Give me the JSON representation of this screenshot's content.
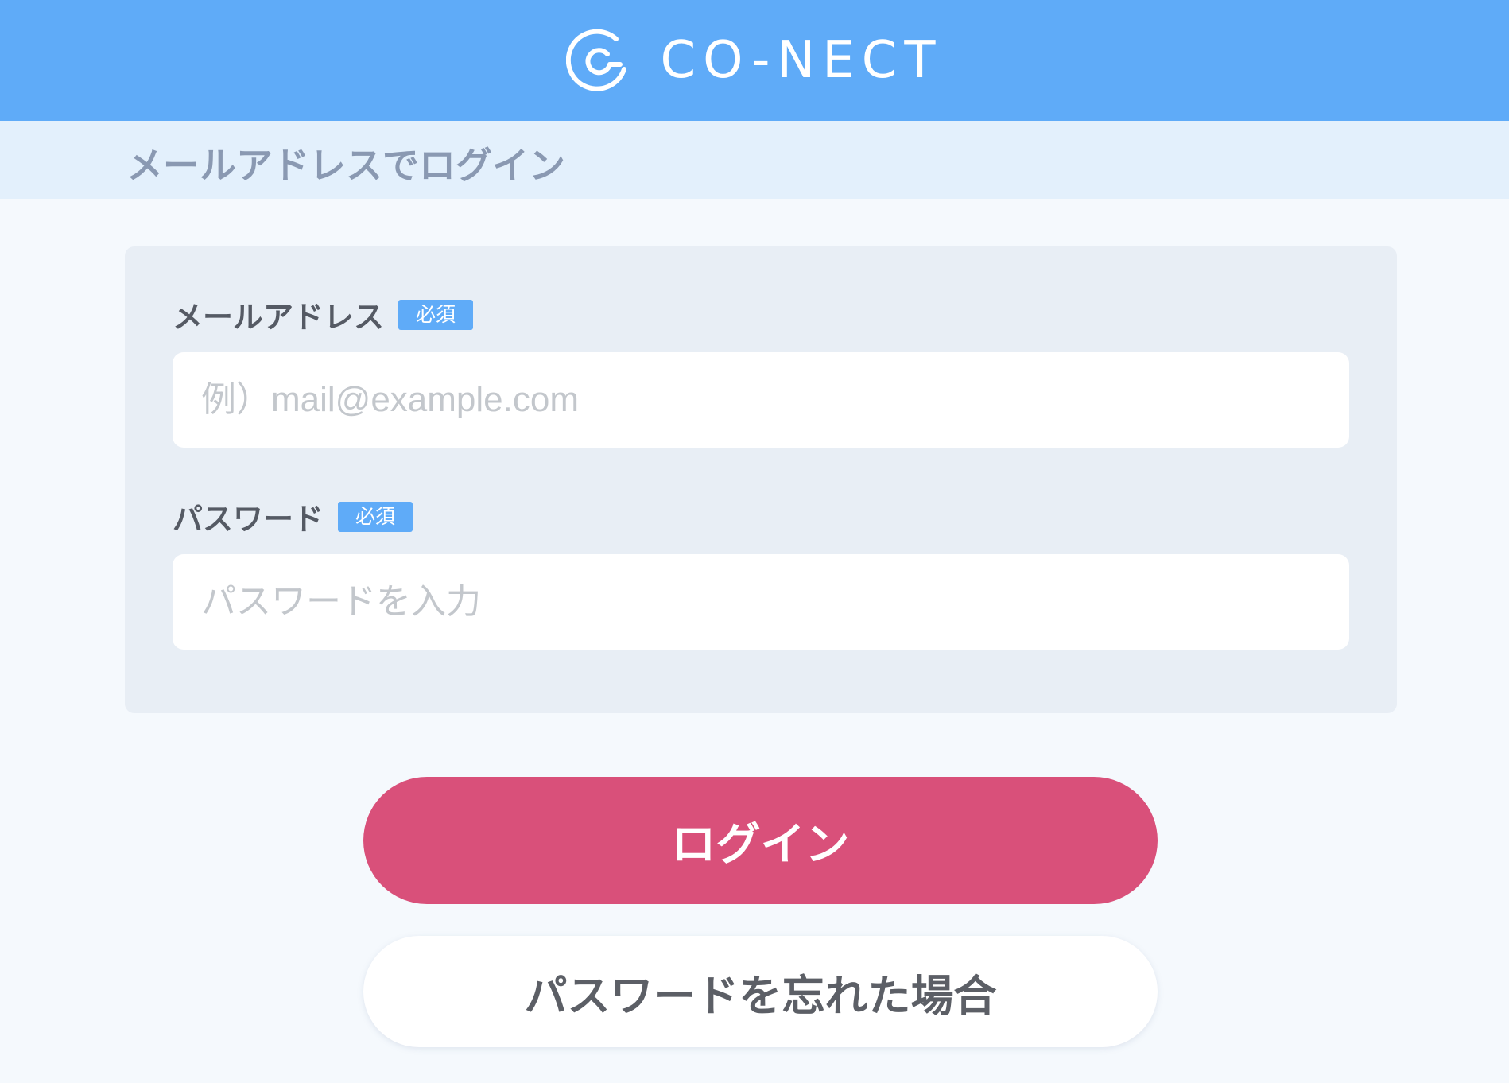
{
  "header": {
    "brand_name": "CO-NECT",
    "logo_icon": "conect-logo-icon",
    "background_color": "#5fabf8"
  },
  "page": {
    "title": "メールアドレスでログイン"
  },
  "form": {
    "email": {
      "label": "メールアドレス",
      "required_badge": "必須",
      "value": "",
      "placeholder": "例）mail@example.com"
    },
    "password": {
      "label": "パスワード",
      "required_badge": "必須",
      "value": "",
      "placeholder": "パスワードを入力"
    }
  },
  "actions": {
    "login_label": "ログイン",
    "forgot_password_label": "パスワードを忘れた場合"
  },
  "colors": {
    "accent": "#5fabf8",
    "primary_button": "#d9507a",
    "label_text": "#555a64",
    "subheader_background": "#e3f0fc"
  }
}
